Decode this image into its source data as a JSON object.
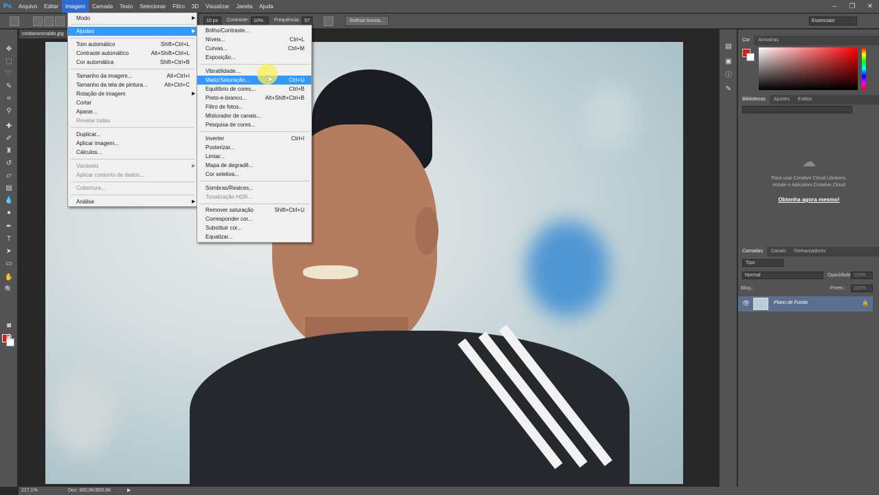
{
  "app": {
    "logo": "Ps"
  },
  "menubar": {
    "items": [
      "Arquivo",
      "Editar",
      "Imagem",
      "Camada",
      "Texto",
      "Selecionar",
      "Filtro",
      "3D",
      "Visualizar",
      "Janela",
      "Ajuda"
    ],
    "active": "Imagem"
  },
  "optionsbar": {
    "size_value": "10 px",
    "contrast_label": "Contraste:",
    "contrast_value": "10%",
    "frequency_label": "Frequência:",
    "frequency_value": "57",
    "refine_button": "Refinar Aresta...",
    "workspace": "Essenciais"
  },
  "document": {
    "tab_title": "cristianoronaldo.jpg"
  },
  "image_menu": {
    "items": [
      {
        "label": "Modo",
        "shortcut": "",
        "submenu": true
      },
      {
        "label": "Ajustes",
        "shortcut": "",
        "submenu": true,
        "highlighted": true
      },
      {
        "label": "Tom automático",
        "shortcut": "Shift+Ctrl+L"
      },
      {
        "label": "Contraste automático",
        "shortcut": "Alt+Shift+Ctrl+L"
      },
      {
        "label": "Cor automática",
        "shortcut": "Shift+Ctrl+B"
      },
      {
        "label": "Tamanho da imagem...",
        "shortcut": "Alt+Ctrl+I"
      },
      {
        "label": "Tamanho da tela de pintura...",
        "shortcut": "Alt+Ctrl+C"
      },
      {
        "label": "Rotação de imagem",
        "shortcut": "",
        "submenu": true
      },
      {
        "label": "Cortar",
        "shortcut": ""
      },
      {
        "label": "Aparar...",
        "shortcut": ""
      },
      {
        "label": "Revelar todas",
        "shortcut": "",
        "disabled": true
      },
      {
        "label": "Duplicar...",
        "shortcut": ""
      },
      {
        "label": "Aplicar imagem...",
        "shortcut": ""
      },
      {
        "label": "Cálculos...",
        "shortcut": ""
      },
      {
        "label": "Variáveis",
        "shortcut": "",
        "submenu": true,
        "disabled": true
      },
      {
        "label": "Aplicar conjunto de dados...",
        "shortcut": "",
        "disabled": true
      },
      {
        "label": "Cobertura...",
        "shortcut": "",
        "disabled": true
      },
      {
        "label": "Análise",
        "shortcut": "",
        "submenu": true
      }
    ]
  },
  "adjust_menu": {
    "items": [
      {
        "label": "Brilho/Contraste...",
        "shortcut": ""
      },
      {
        "label": "Níveis...",
        "shortcut": "Ctrl+L"
      },
      {
        "label": "Curvas...",
        "shortcut": "Ctrl+M"
      },
      {
        "label": "Exposição...",
        "shortcut": ""
      },
      {
        "label": "Vibratilidade...",
        "shortcut": ""
      },
      {
        "label": "Matiz/Saturação...",
        "shortcut": "Ctrl+U",
        "highlighted": true
      },
      {
        "label": "Equilíbrio de cores...",
        "shortcut": "Ctrl+B"
      },
      {
        "label": "Preto-e-branco...",
        "shortcut": "Alt+Shift+Ctrl+B"
      },
      {
        "label": "Filtro de fotos...",
        "shortcut": ""
      },
      {
        "label": "Misturador de canais...",
        "shortcut": ""
      },
      {
        "label": "Pesquisa de cores...",
        "shortcut": ""
      },
      {
        "label": "Inverter",
        "shortcut": "Ctrl+I"
      },
      {
        "label": "Posterizar...",
        "shortcut": ""
      },
      {
        "label": "Limiar...",
        "shortcut": ""
      },
      {
        "label": "Mapa de degradê...",
        "shortcut": ""
      },
      {
        "label": "Cor seletiva...",
        "shortcut": ""
      },
      {
        "label": "Sombras/Realces...",
        "shortcut": ""
      },
      {
        "label": "Tonalização HDR...",
        "shortcut": "",
        "disabled": true
      },
      {
        "label": "Remover saturação",
        "shortcut": "Shift+Ctrl+U"
      },
      {
        "label": "Corresponder cor...",
        "shortcut": ""
      },
      {
        "label": "Substituir cor...",
        "shortcut": ""
      },
      {
        "label": "Equalizar...",
        "shortcut": ""
      }
    ]
  },
  "color_panel": {
    "tabs": [
      "Cor",
      "Amostras"
    ],
    "foreground": "#e3170e",
    "background": "#ffffff"
  },
  "libraries_panel": {
    "tabs": [
      "Bibliotecas",
      "Ajustes",
      "Estilos"
    ],
    "message": "Para usar Creative Cloud Libraries, instale o Aplicativo Creative Cloud",
    "link": "Obtenha agora mesmo!"
  },
  "layers_panel": {
    "tabs": [
      "Camadas",
      "Canais",
      "Demarcadores"
    ],
    "filter": "Tipo",
    "blend_mode": "Normal",
    "opacity_label": "Opacidade:",
    "opacity_value": "100%",
    "lock_label": "Bloq.:",
    "fill_label": "Preen.:",
    "fill_value": "100%",
    "layer_name": "Plano de Fundo"
  },
  "statusbar": {
    "zoom": "217,1%",
    "doc": "Doc: 800,6K/800,6K"
  }
}
